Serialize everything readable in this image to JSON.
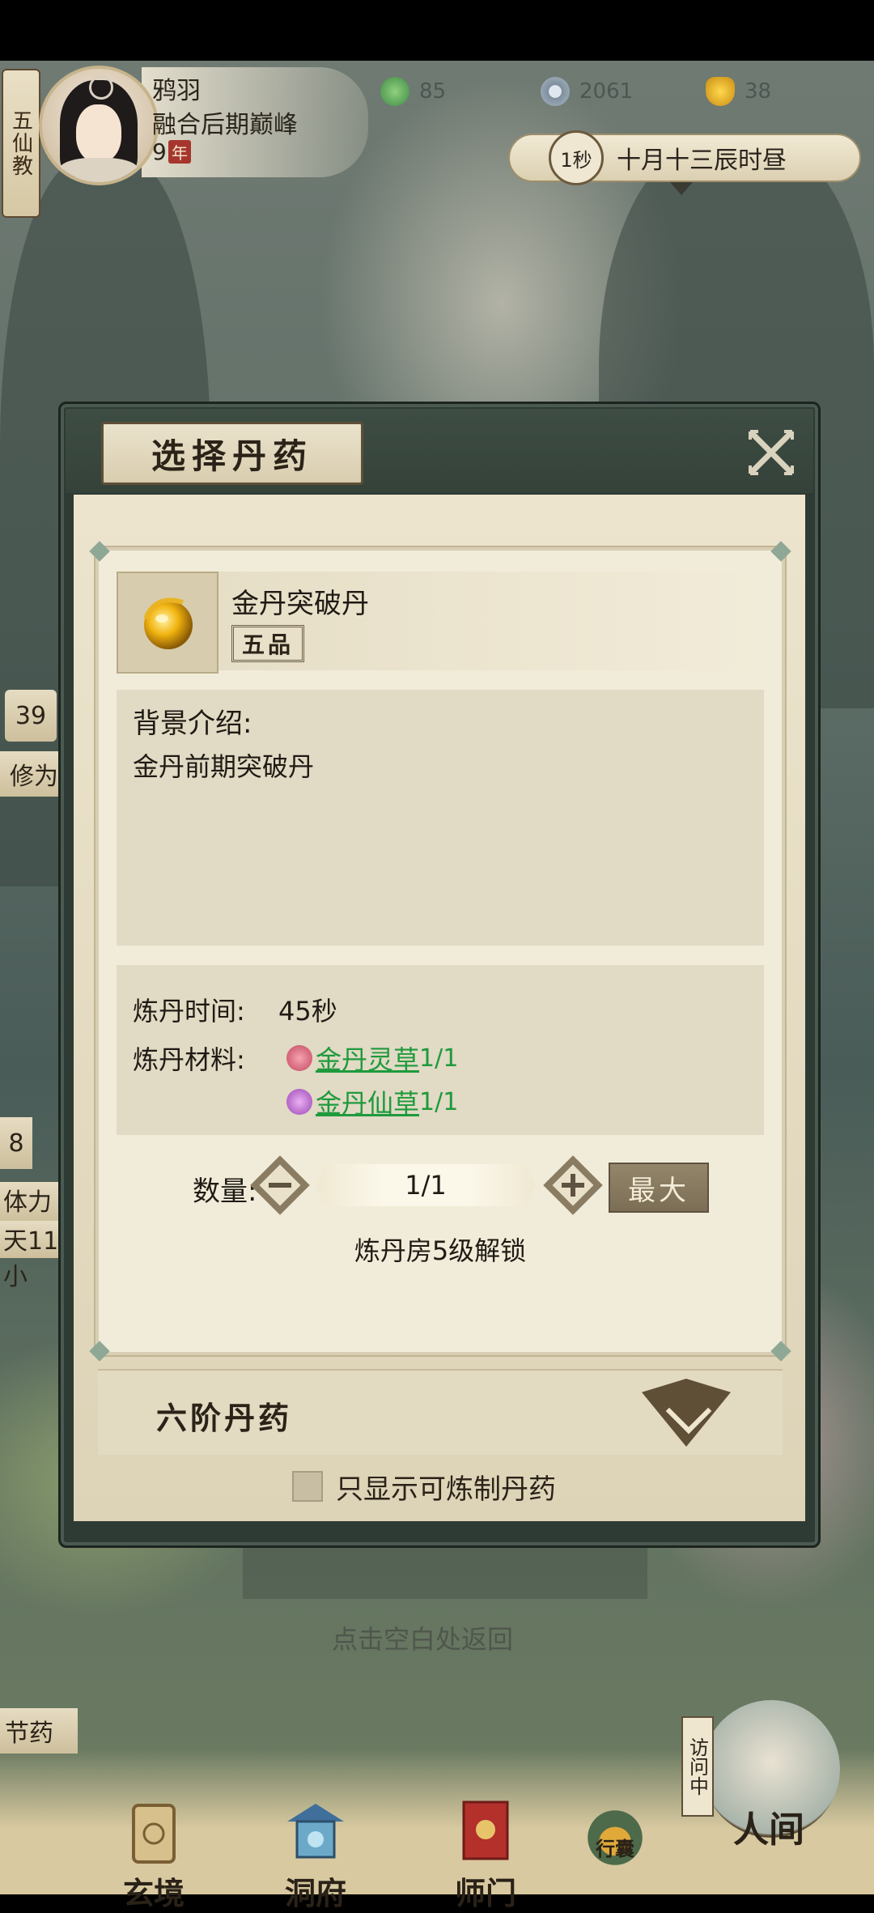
{
  "player": {
    "sect": "五仙教",
    "name": "鸦羽",
    "rank": "融合后期巅峰",
    "age": "9",
    "age_unit": "年"
  },
  "resources": [
    {
      "icon": "jade-icon",
      "value": "85"
    },
    {
      "icon": "coin-icon",
      "value": "2061"
    },
    {
      "icon": "gold-ingot-icon",
      "value": "38"
    }
  ],
  "time": {
    "speed": "1秒",
    "date": "十月十三辰时昼"
  },
  "background_peek": {
    "level_a": "39",
    "label_a": "修为",
    "level_b": "8",
    "label_b": "体力",
    "label_c": "天11小",
    "label_d": "节药"
  },
  "dialog": {
    "title": "选择丹药",
    "grade_section": "六阶丹药",
    "filter_label": "只显示可炼制丹药"
  },
  "item": {
    "name": "金丹突破丹",
    "grade": "五品",
    "desc_title": "背景介绍:",
    "desc_text": "金丹前期突破丹",
    "time_label": "炼丹时间:",
    "time_value": "45秒",
    "materials_label": "炼丹材料:",
    "materials": [
      {
        "name": "金丹灵草",
        "count": "1/1",
        "color": "#d66a7a"
      },
      {
        "name": "金丹仙草",
        "count": "1/1",
        "color": "#b55cc9"
      }
    ],
    "qty_label": "数量:",
    "qty_value": "1/1",
    "max_label": "最大",
    "unlock_text": "炼丹房5级解锁"
  },
  "hint": "点击空白处返回",
  "nav": [
    {
      "label": "玄境",
      "icon": "scroll-icon"
    },
    {
      "label": "洞府",
      "icon": "pavilion-icon"
    },
    {
      "label": "师门",
      "icon": "banner-icon"
    },
    {
      "label": "行囊",
      "icon": "pouch-icon"
    },
    {
      "label": "人间",
      "icon": "world-icon"
    }
  ],
  "visit_badge": "访问中",
  "colors": {
    "material_link": "#1f9a3d",
    "accent_brown": "#5e4f37",
    "dialog_frame": "#2e3b34"
  }
}
